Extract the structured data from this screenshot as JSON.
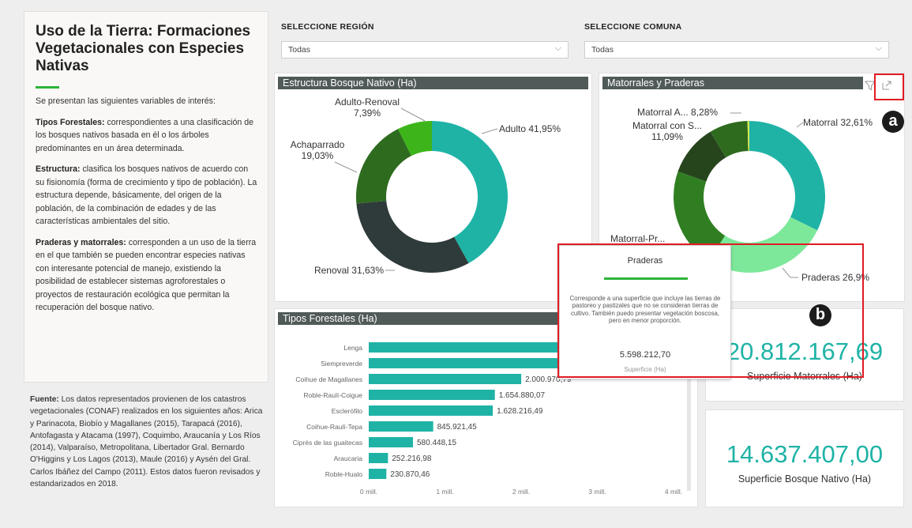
{
  "left_panel": {
    "title": "Uso de la Tierra: Formaciones Vegetacionales con Especies Nativas",
    "intro": "Se presentan las siguientes variables de interés:",
    "sections": [
      {
        "heading": "Tipos Forestales:",
        "text": " correspondientes a una clasificación de los bosques nativos basada en él o los árboles predominantes en un área determinada."
      },
      {
        "heading": "Estructura:",
        "text": " clasifica los bosques nativos de acuerdo con su fisionomía (forma de crecimiento y tipo de población). La estructura depende, básicamente, del origen de la población, de la combinación de edades y de las características ambientales del sitio."
      },
      {
        "heading": "Praderas y matorrales:",
        "text": " corresponden a un uso de la tierra en el que también se pueden encontrar especies nativas con interesante potencial de manejo, existiendo la posibilidad de establecer sistemas agroforestales o proyectos de restauración ecológica que permitan la recuperación del bosque nativo."
      }
    ]
  },
  "source": {
    "heading": "Fuente:",
    "text": " Los datos representados provienen de los catastros vegetacionales (CONAF) realizados en los siguientes años: Arica y Parinacota, Biobío y Magallanes (2015), Tarapacá (2016), Antofagasta y Atacama (1997), Coquimbo, Araucanía y Los Ríos (2014), Valparaíso, Metropolitana, Libertador Gral. Bernardo O'Higgins y Los Lagos (2013), Maule (2016) y Aysén del Gral. Carlos Ibáñez del Campo (2011). Estos datos fueron revisados y estandarizados en 2018."
  },
  "filters": {
    "region": {
      "label": "SELECCIONE REGIÓN",
      "value": "Todas"
    },
    "comuna": {
      "label": "SELECCIONE COMUNA",
      "value": "Todas"
    }
  },
  "cards": {
    "estructura_title": "Estructura Bosque Nativo (Ha)",
    "matorrales_title": "Matorrales y Praderas",
    "tipos_title": "Tipos Forestales (Ha)"
  },
  "kpis": {
    "matorrales": {
      "value": "20.812.167,69",
      "label": "Superficie Matorrales (Ha)"
    },
    "bosque": {
      "value": "14.637.407,00",
      "label": "Superficie Bosque Nativo (Ha)"
    }
  },
  "tooltip": {
    "title": "Praderas",
    "description": "Corresponde a una superficie que incluye las tierras de pastoreo y pastizales que no se consideran tierras de cultivo. También puedo presentar vegetación boscosa, pero en menor proporción.",
    "value": "5.598.212,70",
    "sub": "Superficie (Ha)"
  },
  "markers": {
    "a": "a",
    "b": "b"
  },
  "colors": {
    "teal": "#1fb3a6",
    "dark": "#2f3b3a",
    "green": "#2e7d1e",
    "bright_green": "#3db51a",
    "light_green": "#7de89a",
    "accent": "#2db33a",
    "highlight": "#e11b22"
  },
  "chart_data": [
    {
      "type": "pie",
      "title": "Estructura Bosque Nativo (Ha)",
      "donut": true,
      "slices": [
        {
          "name": "Adulto",
          "label": "Adulto 41,95%",
          "value": 41.95,
          "color": "#1fb3a6"
        },
        {
          "name": "Renoval",
          "label": "Renoval 31,63%",
          "value": 31.63,
          "color": "#2f3b3a"
        },
        {
          "name": "Achaparrado",
          "label": "Achaparrado\n19,03%",
          "value": 19.03,
          "color": "#2e6b1f"
        },
        {
          "name": "Adulto-Renoval",
          "label": "Adulto-Renoval\n7,39%",
          "value": 7.39,
          "color": "#3db51a"
        }
      ]
    },
    {
      "type": "pie",
      "title": "Matorrales y Praderas",
      "donut": true,
      "slices": [
        {
          "name": "Matorral",
          "label": "Matorral 32,61%",
          "value": 32.61,
          "color": "#1fb3a6"
        },
        {
          "name": "Praderas",
          "label": "Praderas 26,9%",
          "value": 26.9,
          "color": "#7de89a"
        },
        {
          "name": "Matorral-Pr...",
          "label": "Matorral-Pr...",
          "value": 21.72,
          "color": "#2f7f22"
        },
        {
          "name": "Matorral con S...",
          "label": "Matorral con S...\n11,09%",
          "value": 11.09,
          "color": "#26451d"
        },
        {
          "name": "Matorral A...",
          "label": "Matorral A... 8,28%",
          "value": 8.28,
          "color": "#2e6b1f"
        },
        {
          "name": "Otro",
          "label": "",
          "value": 0.4,
          "color": "#d7e84a"
        }
      ]
    },
    {
      "type": "bar",
      "orientation": "horizontal",
      "title": "Tipos Forestales (Ha)",
      "categories": [
        "Lenga",
        "Siempreverde",
        "Coihue de Magallanes",
        "Roble-Raulí-Coigue",
        "Esclerófilo",
        "Coihue-Raulí-Tepa",
        "Ciprés de las guaitecas",
        "Araucaria",
        "Roble-Hualo"
      ],
      "values": [
        3450000,
        4100000,
        2000970.79,
        1654880.07,
        1628216.49,
        845921.45,
        580448.15,
        252216.98,
        230870.46
      ],
      "data_labels": [
        "",
        "",
        "2.000.970,79",
        "1.654.880,07",
        "1.628.216,49",
        "845.921,45",
        "580.448,15",
        "252.216,98",
        "230.870,46"
      ],
      "xlim": [
        0,
        4000000
      ],
      "ticks": [
        0,
        1000000,
        2000000,
        3000000,
        4000000
      ],
      "tick_labels": [
        "0 mill.",
        "1 mill.",
        "2 mill.",
        "3 mill.",
        "4 mill."
      ],
      "color": "#1fb3a6"
    }
  ]
}
